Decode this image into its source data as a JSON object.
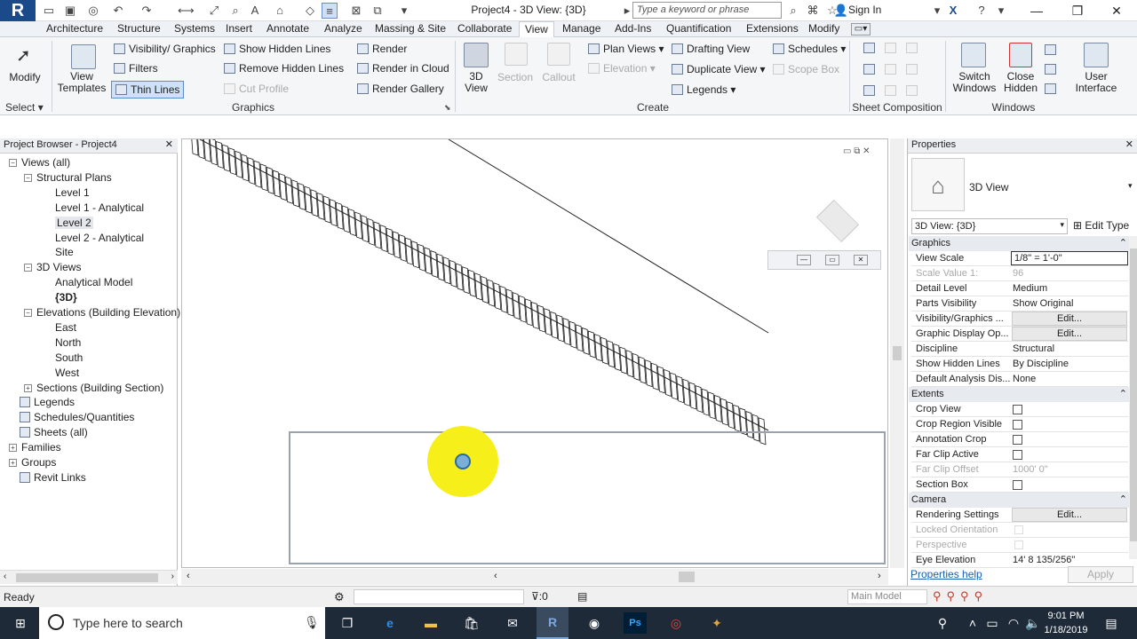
{
  "title_bar": {
    "doc_title": "Project4 - 3D View: {3D}",
    "search_placeholder": "Type a keyword or phrase",
    "sign_in": "Sign In",
    "logo": "R"
  },
  "tabs": [
    "Architecture",
    "Structure",
    "Systems",
    "Insert",
    "Annotate",
    "Analyze",
    "Massing & Site",
    "Collaborate",
    "View",
    "Manage",
    "Add-Ins",
    "Quantification",
    "Extensions",
    "Modify"
  ],
  "active_tab": "View",
  "ribbon": {
    "modify": "Modify",
    "select": "Select",
    "view_templates": "View Templates",
    "visibility_graphics": "Visibility/ Graphics",
    "filters": "Filters",
    "thin_lines": "Thin Lines",
    "show_hidden_lines": "Show Hidden Lines",
    "remove_hidden_lines": "Remove Hidden Lines",
    "cut_profile": "Cut Profile",
    "render": "Render",
    "render_in_cloud": "Render in Cloud",
    "render_gallery": "Render Gallery",
    "view_3d": "3D View",
    "section": "Section",
    "callout": "Callout",
    "plan_views": "Plan Views",
    "elevation": "Elevation",
    "drafting_view": "Drafting View",
    "duplicate_view": "Duplicate View",
    "legends": "Legends",
    "schedules": "Schedules",
    "scope_box": "Scope Box",
    "switch_windows": "Switch Windows",
    "close_hidden": "Close Hidden",
    "user_interface": "User Interface",
    "panel_graphics": "Graphics",
    "panel_create": "Create",
    "panel_sheet": "Sheet Composition",
    "panel_windows": "Windows"
  },
  "project_browser": {
    "title": "Project Browser - Project4",
    "items": [
      {
        "label": "Views (all)",
        "level": 0,
        "exp": "−"
      },
      {
        "label": "Structural Plans",
        "level": 1,
        "exp": "−"
      },
      {
        "label": "Level 1",
        "level": 2
      },
      {
        "label": "Level 1 - Analytical",
        "level": 2
      },
      {
        "label": "Level 2",
        "level": 2,
        "selected": true
      },
      {
        "label": "Level 2 - Analytical",
        "level": 2
      },
      {
        "label": "Site",
        "level": 2
      },
      {
        "label": "3D Views",
        "level": 1,
        "exp": "−"
      },
      {
        "label": "Analytical Model",
        "level": 2
      },
      {
        "label": "{3D}",
        "level": 2,
        "bold": true
      },
      {
        "label": "Elevations (Building Elevation)",
        "level": 1,
        "exp": "−"
      },
      {
        "label": "East",
        "level": 2
      },
      {
        "label": "North",
        "level": 2
      },
      {
        "label": "South",
        "level": 2
      },
      {
        "label": "West",
        "level": 2
      },
      {
        "label": "Sections (Building Section)",
        "level": 1,
        "exp": "+"
      },
      {
        "label": "Legends",
        "level": 0
      },
      {
        "label": "Schedules/Quantities",
        "level": 0
      },
      {
        "label": "Sheets (all)",
        "level": 0
      },
      {
        "label": "Families",
        "level": 0,
        "exp": "+"
      },
      {
        "label": "Groups",
        "level": 0,
        "exp": "+"
      },
      {
        "label": "Revit Links",
        "level": 0
      }
    ]
  },
  "properties": {
    "title": "Properties",
    "type_name": "3D View",
    "instance": "3D View: {3D}",
    "edit_type": "Edit Type",
    "sections": [
      {
        "name": "Graphics",
        "rows": [
          {
            "n": "View Scale",
            "v": "1/8\" = 1'-0\""
          },
          {
            "n": "Scale Value    1:",
            "v": "96",
            "dim": true
          },
          {
            "n": "Detail Level",
            "v": "Medium"
          },
          {
            "n": "Parts Visibility",
            "v": "Show Original"
          },
          {
            "n": "Visibility/Graphics ...",
            "v": "Edit...",
            "btn": true
          },
          {
            "n": "Graphic Display Op...",
            "v": "Edit...",
            "btn": true
          },
          {
            "n": "Discipline",
            "v": "Structural"
          },
          {
            "n": "Show Hidden Lines",
            "v": "By Discipline"
          },
          {
            "n": "Default Analysis Dis...",
            "v": "None"
          }
        ]
      },
      {
        "name": "Extents",
        "rows": [
          {
            "n": "Crop View",
            "v": "",
            "cb": true
          },
          {
            "n": "Crop Region Visible",
            "v": "",
            "cb": true
          },
          {
            "n": "Annotation Crop",
            "v": "",
            "cb": true
          },
          {
            "n": "Far Clip Active",
            "v": "",
            "cb": true
          },
          {
            "n": "Far Clip Offset",
            "v": "1000'  0\"",
            "dim": true
          },
          {
            "n": "Section Box",
            "v": "",
            "cb": true
          }
        ]
      },
      {
        "name": "Camera",
        "rows": [
          {
            "n": "Rendering Settings",
            "v": "Edit...",
            "btn": true
          },
          {
            "n": "Locked Orientation",
            "v": "",
            "dim": true
          },
          {
            "n": "Perspective",
            "v": "",
            "dim": true
          },
          {
            "n": "Eye Elevation",
            "v": "14'  8 135/256\""
          }
        ]
      }
    ],
    "help": "Properties help",
    "apply": "Apply"
  },
  "status": {
    "left": "Ready",
    "filter_count": ":0",
    "model": "Main Model"
  },
  "taskbar": {
    "search": "Type here to search",
    "time": "9:01 PM",
    "date": "1/18/2019"
  }
}
